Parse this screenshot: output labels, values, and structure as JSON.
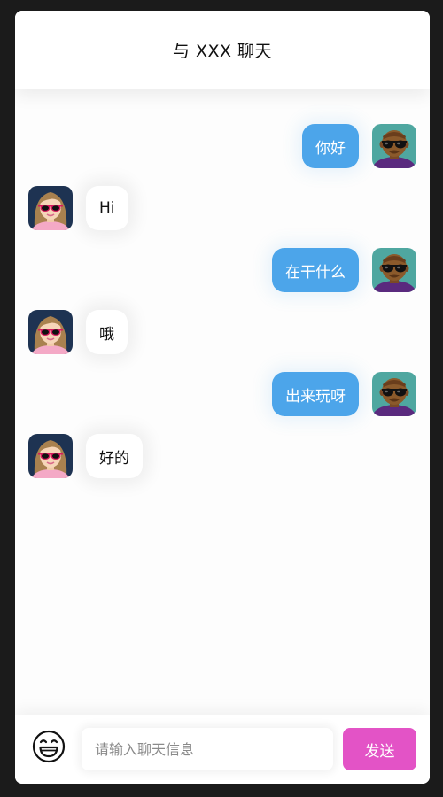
{
  "header": {
    "title": "与 XXX 聊天"
  },
  "messages": [
    {
      "from": "me",
      "text": "你好"
    },
    {
      "from": "other",
      "text": "Hi"
    },
    {
      "from": "me",
      "text": "在干什么"
    },
    {
      "from": "other",
      "text": "哦"
    },
    {
      "from": "me",
      "text": "出来玩呀"
    },
    {
      "from": "other",
      "text": "好的"
    }
  ],
  "input": {
    "placeholder": "请输入聊天信息",
    "value": ""
  },
  "send_label": "发送",
  "icons": {
    "emoji": "grinning-face-icon",
    "my_avatar": "man-sunglasses-avatar",
    "other_avatar": "woman-sunglasses-avatar"
  },
  "colors": {
    "my_bubble": "#4ca5ea",
    "other_bubble": "#ffffff",
    "send_button": "#e353c6"
  }
}
